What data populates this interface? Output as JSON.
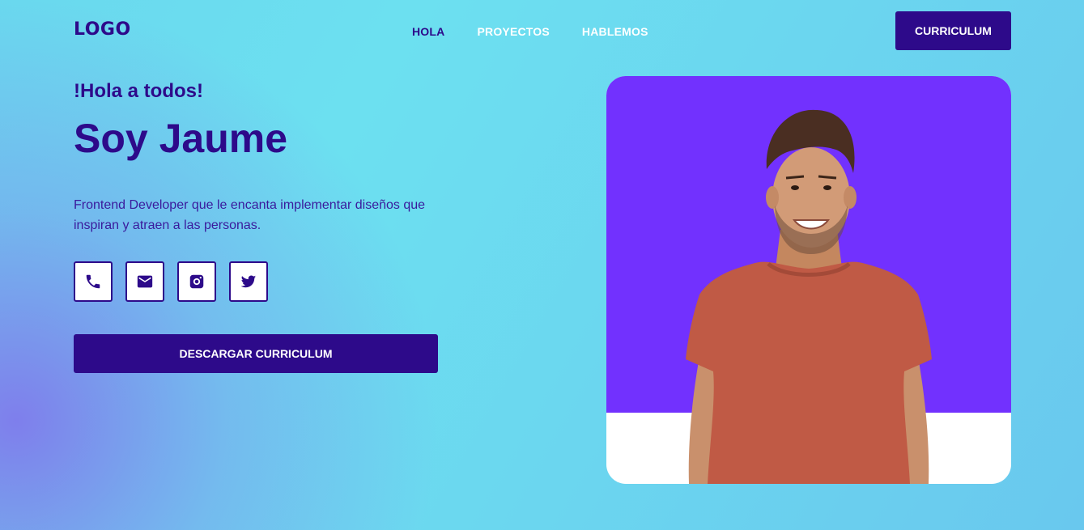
{
  "header": {
    "logo": "LOGO",
    "nav": [
      {
        "label": "HOLA",
        "active": true
      },
      {
        "label": "PROYECTOS",
        "active": false
      },
      {
        "label": "HABLEMOS",
        "active": false
      }
    ],
    "cv_button": "CURRICULUM"
  },
  "hero": {
    "greeting": "!Hola a todos!",
    "name": "Soy Jaume",
    "description": "Frontend Developer que le encanta implementar diseños que inspiran y atraen a las personas.",
    "socials": [
      {
        "icon": "phone-icon"
      },
      {
        "icon": "email-icon"
      },
      {
        "icon": "instagram-icon"
      },
      {
        "icon": "twitter-icon"
      }
    ],
    "download_button": "DESCARGAR CURRICULUM"
  },
  "colors": {
    "primary": "#2d0a8a",
    "photo_background": "#7231fe",
    "shirt": "#c05a45"
  }
}
